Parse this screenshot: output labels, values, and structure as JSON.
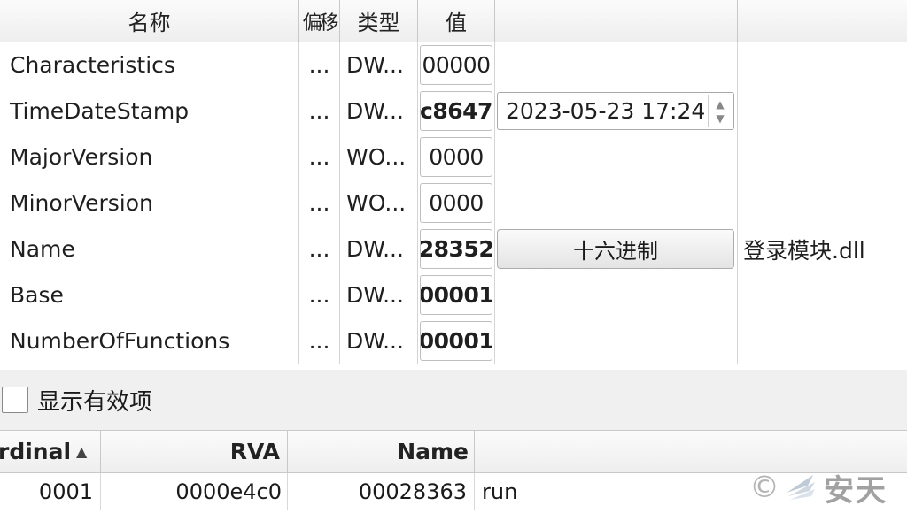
{
  "grid": {
    "headers": {
      "name": "名称",
      "offset": "偏移",
      "type": "类型",
      "value": "值"
    },
    "rows": [
      {
        "name": "Characteristics",
        "offset": "...",
        "type": "DW...",
        "value": "00000",
        "value_bold": false,
        "editor": "",
        "extra": ""
      },
      {
        "name": "TimeDateStamp",
        "offset": "...",
        "type": "DW...",
        "value": "c8647",
        "value_bold": true,
        "editor": "datetime",
        "extra": ""
      },
      {
        "name": "MajorVersion",
        "offset": "...",
        "type": "WO...",
        "value": "0000",
        "value_bold": false,
        "editor": "",
        "extra": ""
      },
      {
        "name": "MinorVersion",
        "offset": "...",
        "type": "WO...",
        "value": "0000",
        "value_bold": false,
        "editor": "",
        "extra": ""
      },
      {
        "name": "Name",
        "offset": "...",
        "type": "DW...",
        "value": "28352",
        "value_bold": true,
        "editor": "button",
        "extra": "登录模块.dll"
      },
      {
        "name": "Base",
        "offset": "...",
        "type": "DW...",
        "value": "00001",
        "value_bold": true,
        "editor": "",
        "extra": ""
      },
      {
        "name": "NumberOfFunctions",
        "offset": "...",
        "type": "DW...",
        "value": "00001",
        "value_bold": true,
        "editor": "",
        "extra": ""
      }
    ],
    "datetime_value": "2023-05-23 17:24",
    "hex_button_label": "十六进制"
  },
  "checkbox": {
    "label": "显示有效项",
    "checked": false
  },
  "exports": {
    "headers": {
      "ordinal": "rdinal",
      "rva": "RVA",
      "name": "Name"
    },
    "sort_arrow": "▲",
    "rows": [
      {
        "ordinal": "0001",
        "rva": "0000e4c0",
        "name_rva": "00028363",
        "name": "run"
      }
    ]
  },
  "watermark": {
    "copyright": "©",
    "text": "安天",
    "icon": "antiy-logo-icon"
  }
}
